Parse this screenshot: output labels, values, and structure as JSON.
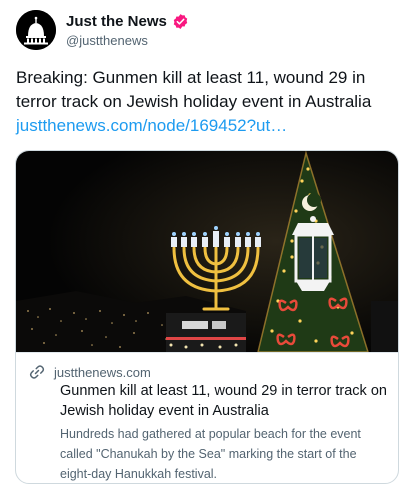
{
  "author": {
    "display_name": "Just the News",
    "handle": "@justthenews",
    "avatar_icon": "capitol-dome-logo-icon",
    "verified_icon": "verified-badge-icon",
    "verified_color": "#f91880"
  },
  "tweet": {
    "text": "Breaking: Gunmen kill at least 11, wound 29 in terror track on Jewish holiday event in Australia ",
    "link": "justthenews.com/node/169452?ut…",
    "link_color": "#1d9bf0"
  },
  "card": {
    "image_icon": "hanukkah-menorah-and-christmas-tree-photo",
    "domain_icon": "link-icon",
    "domain": "justthenews.com",
    "title": "Gunmen kill at least 11, wound 29 in terror track on Jewish holiday event in Australia",
    "description": "Hundreds had gathered at popular beach for the event called \"Chanukah by the Sea\" marking the start of the eight-day Hanukkah festival."
  }
}
